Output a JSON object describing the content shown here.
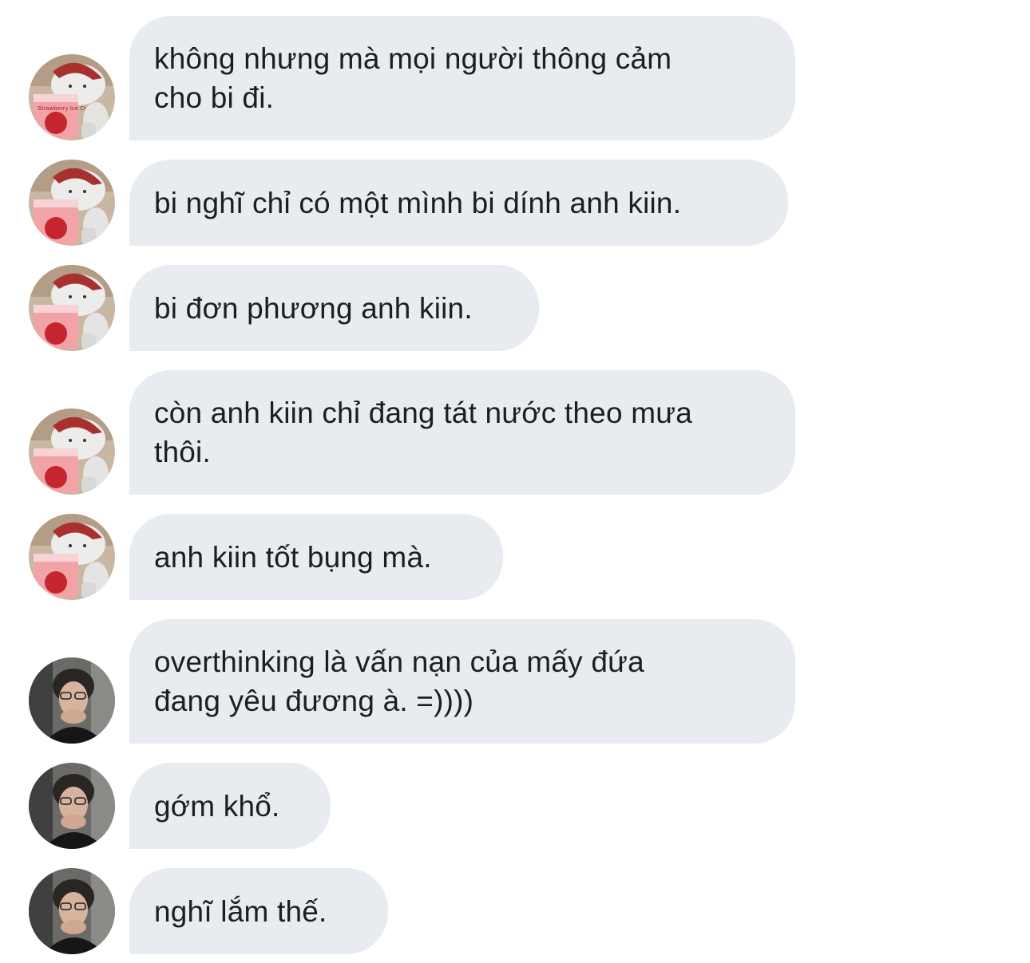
{
  "conversation": {
    "messages": [
      {
        "sender": "bear",
        "text": "không nhưng mà mọi người thông cảm\ncho bi đi."
      },
      {
        "sender": "bear",
        "text": "bi nghĩ chỉ có một mình bi dính anh kiin."
      },
      {
        "sender": "bear",
        "text": "bi đơn phương anh kiin."
      },
      {
        "sender": "bear",
        "text": "còn anh kiin chỉ đang tát nước theo mưa\nthôi."
      },
      {
        "sender": "bear",
        "text": "anh kiin tốt bụng mà."
      },
      {
        "sender": "boy",
        "text": "overthinking là vấn nạn của mấy đứa\nđang yêu đương à. =))))"
      },
      {
        "sender": "boy",
        "text": "gớm khổ."
      },
      {
        "sender": "boy",
        "text": "nghĩ lắm thế."
      }
    ]
  },
  "avatars": {
    "bear": {
      "icon": "polar-bear-ice-cream-avatar-icon",
      "label": "Strawberry Ice Cream"
    },
    "boy": {
      "icon": "young-man-photo-avatar-icon"
    }
  },
  "colors": {
    "bubble": "#e8ebef",
    "text": "#1c1e21",
    "background": "#ffffff"
  }
}
